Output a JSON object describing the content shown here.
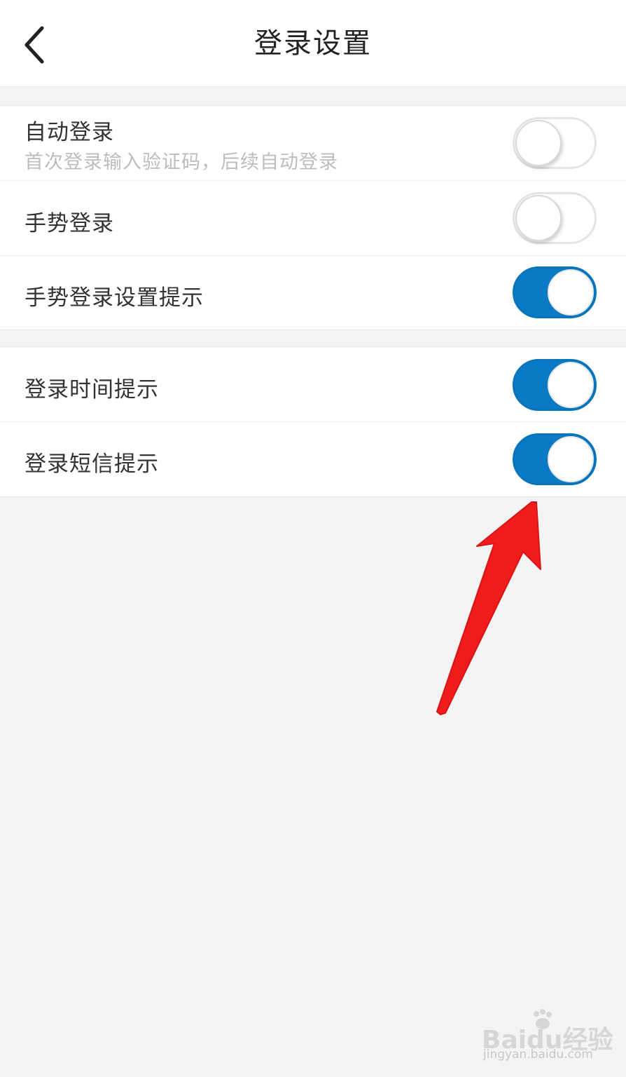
{
  "header": {
    "title": "登录设置",
    "back_icon": "chevron-left-icon"
  },
  "groups": [
    {
      "rows": [
        {
          "label": "自动登录",
          "subtitle": "首次登录输入验证码，后续自动登录",
          "enabled": false
        },
        {
          "label": "手势登录",
          "enabled": false
        },
        {
          "label": "手势登录设置提示",
          "enabled": true
        }
      ]
    },
    {
      "rows": [
        {
          "label": "登录时间提示",
          "enabled": true
        },
        {
          "label": "登录短信提示",
          "enabled": true
        }
      ]
    }
  ],
  "colors": {
    "toggle_on": "#0a7ac7",
    "annotation_arrow": "#f01c1c",
    "page_background": "#f4f4f4"
  },
  "annotation": {
    "icon": "red-arrow-annotation",
    "points_to": "登录短信提示"
  },
  "watermark": {
    "logo_text": "Baidu经验",
    "url": "jingyan.baidu.com"
  }
}
